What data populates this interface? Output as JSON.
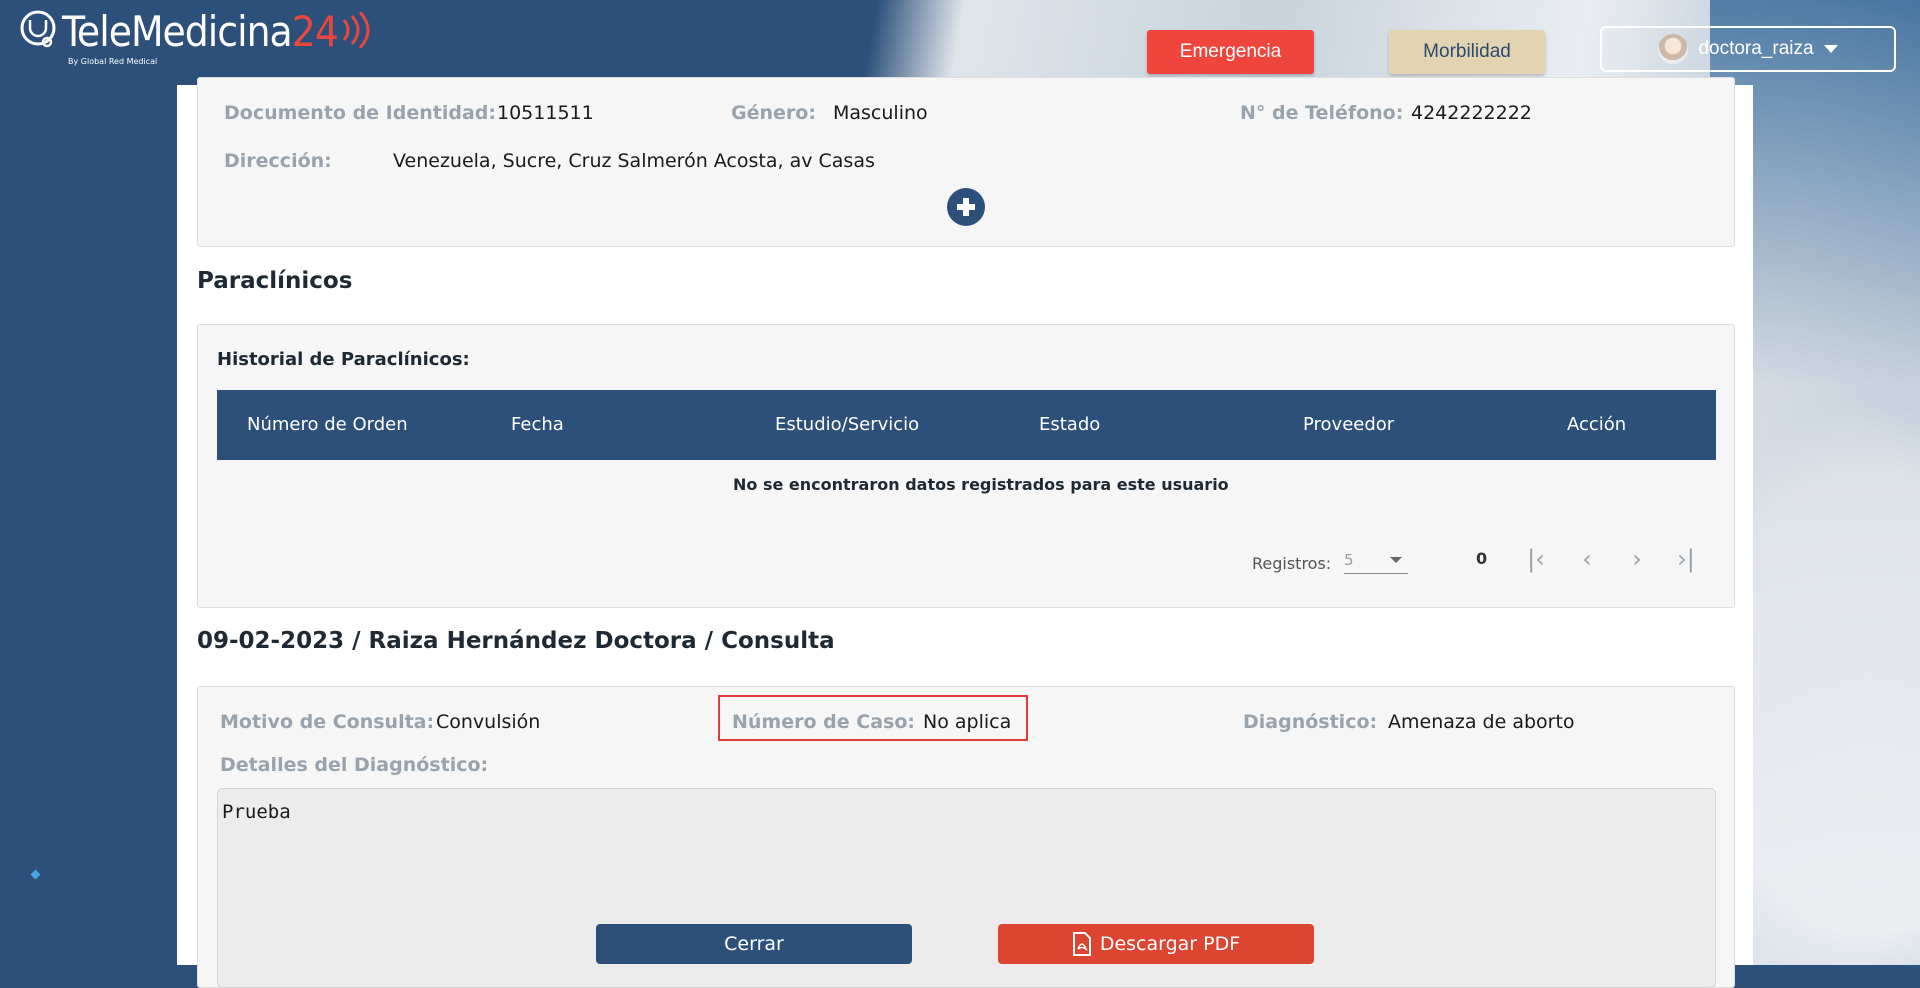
{
  "brand": {
    "name_main": "TeleMedicina",
    "name_num": "24",
    "tagline": "By Global Red Medical"
  },
  "header": {
    "emergency_label": "Emergencia",
    "morbidity_label": "Morbilidad",
    "user_label": "doctora_raiza"
  },
  "patient": {
    "id_label": "Documento de Identidad:",
    "id_value": "10511511",
    "gender_label": "Género:",
    "gender_value": "Masculino",
    "phone_label": "N° de Teléfono:",
    "phone_value": "4242222222",
    "address_label": "Dirección:",
    "address_value": "Venezuela, Sucre, Cruz Salmerón Acosta, av Casas"
  },
  "paraclinicos": {
    "title": "Paraclínicos",
    "history_title": "Historial de Paraclínicos:",
    "columns": [
      "Número de Orden",
      "Fecha",
      "Estudio/Servicio",
      "Estado",
      "Proveedor",
      "Acción"
    ],
    "empty_message": "No se encontraron datos registrados para este usuario",
    "pager": {
      "records_label": "Registros:",
      "page_size": "5",
      "count": "0"
    }
  },
  "consulta": {
    "title": "09-02-2023 / Raiza Hernández Doctora / Consulta",
    "reason_label": "Motivo de Consulta:",
    "reason_value": "Convulsión",
    "case_label": "Número de Caso:",
    "case_value": "No aplica",
    "diagnosis_label": "Diagnóstico:",
    "diagnosis_value": "Amenaza de aborto",
    "details_label": "Detalles del Diagnóstico:",
    "details_value": "Prueba",
    "close_label": "Cerrar",
    "pdf_label": "Descargar PDF"
  },
  "colors": {
    "primary": "#2c5079",
    "emergency": "#f0453c",
    "morbidity": "#e3d3b3",
    "pdf": "#db4532",
    "highlight": "#e03a3a"
  }
}
